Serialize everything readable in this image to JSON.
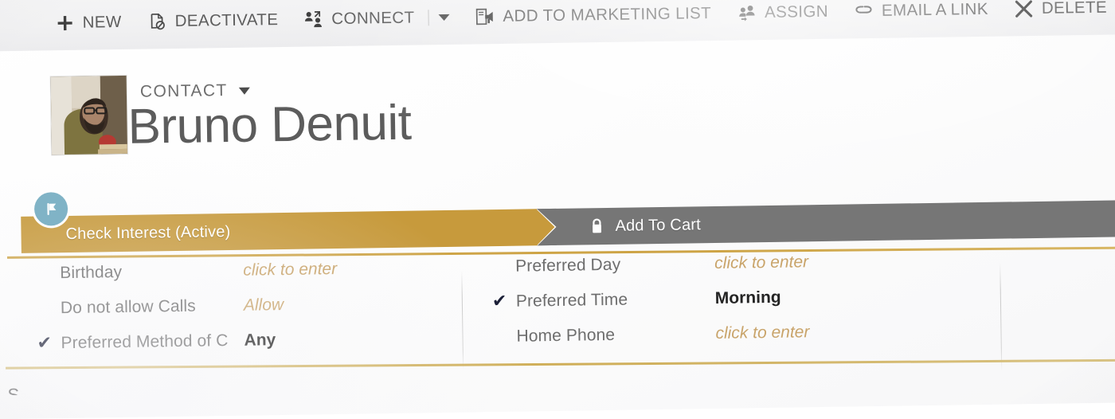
{
  "command_bar": {
    "items": [
      {
        "label": "NEW",
        "icon": "plus-icon"
      },
      {
        "label": "DEACTIVATE",
        "icon": "deactivate-document-icon"
      },
      {
        "label": "CONNECT",
        "icon": "connect-people-icon",
        "has_split_dropdown": true
      },
      {
        "label": "ADD TO MARKETING LIST",
        "icon": "marketing-list-megaphone-icon"
      },
      {
        "label": "ASSIGN",
        "icon": "assign-people-icon"
      },
      {
        "label": "EMAIL A LINK",
        "icon": "link-icon"
      },
      {
        "label": "DELETE",
        "icon": "close-x-icon"
      }
    ]
  },
  "record_header": {
    "entity_type": "CONTACT",
    "record_name": "Bruno Denuit",
    "avatar_alt": "contact-photo"
  },
  "process_flow": {
    "active_stage": {
      "label": "Check Interest (Active)",
      "badge_icon": "flag-icon",
      "color": "#c79a3c"
    },
    "next_stage": {
      "label": "Add To Cart",
      "icon": "lock-icon",
      "color": "#767676"
    }
  },
  "fields": {
    "left_column": [
      {
        "checked": false,
        "label": "Birthday",
        "value": "click to enter",
        "state": "empty"
      },
      {
        "checked": false,
        "label": "Do not allow Calls",
        "value": "Allow",
        "state": "soft"
      },
      {
        "checked": true,
        "label": "Preferred Method of C",
        "value": "Any",
        "state": "set"
      }
    ],
    "right_column": [
      {
        "checked": false,
        "label": "Preferred Day",
        "value": "click to enter",
        "state": "empty"
      },
      {
        "checked": true,
        "label": "Preferred Time",
        "value": "Morning",
        "state": "set"
      },
      {
        "checked": false,
        "label": "Home Phone",
        "value": "click to enter",
        "state": "empty"
      }
    ],
    "check_glyph": "✔"
  },
  "next_section_peek": "S",
  "colors": {
    "stage_active_gold": "#c79a3c",
    "stage_next_gray": "#767676",
    "badge_teal": "#80b3c6",
    "empty_value_gold": "#c9a46a",
    "label_gray": "#6d6d6d",
    "command_text_gray": "#5d5d5d"
  }
}
